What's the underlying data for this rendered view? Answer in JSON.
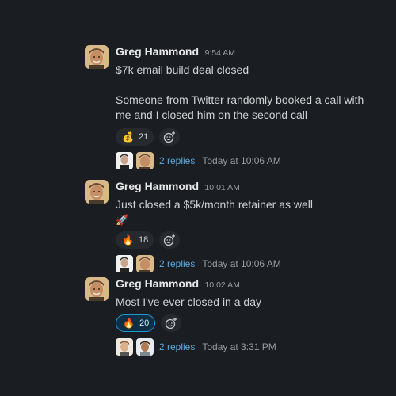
{
  "messages": [
    {
      "author": "Greg Hammond",
      "time": "9:54 AM",
      "lines": [
        "$7k email build deal closed",
        "",
        "Someone from Twitter randomly booked a call with me and I closed him on the second call"
      ],
      "reaction": {
        "emoji": "💰",
        "count": "21",
        "active": false
      },
      "thread": {
        "replies": "2 replies",
        "last": "Today at 10:06 AM"
      }
    },
    {
      "author": "Greg Hammond",
      "time": "10:01 AM",
      "lines": [
        "Just closed a $5k/month retainer as well",
        "🚀"
      ],
      "reaction": {
        "emoji": "🔥",
        "count": "18",
        "active": false
      },
      "thread": {
        "replies": "2 replies",
        "last": "Today at 10:06 AM"
      }
    },
    {
      "author": "Greg Hammond",
      "time": "10:02 AM",
      "lines": [
        "Most I've ever closed in a day"
      ],
      "reaction": {
        "emoji": "🔥",
        "count": "20",
        "active": true
      },
      "thread": {
        "replies": "2 replies",
        "last": "Today at 3:31 PM"
      }
    }
  ],
  "icons": {
    "add_reaction": "add-reaction-icon",
    "avatar": "user-avatar"
  },
  "colors": {
    "background": "#1a1d21",
    "link": "#5ea8d8",
    "reaction_active_border": "#1d9bd1"
  }
}
